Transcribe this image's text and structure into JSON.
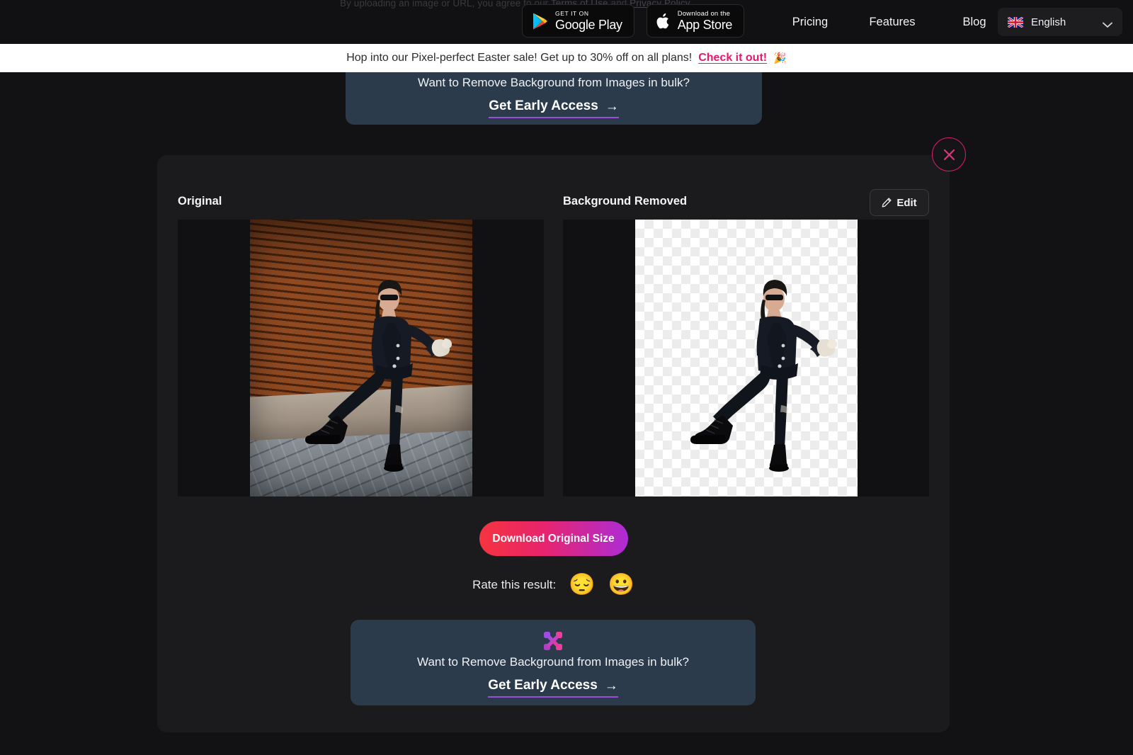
{
  "topnav": {
    "legal_prefix": "By uploading an image or URL, you agree to our ",
    "legal_terms": "Terms of Use",
    "legal_mid": " and ",
    "legal_privacy": "Privacy Policy",
    "legal_suffix": ".",
    "badges": [
      {
        "name": "google-play",
        "small": "GET IT ON",
        "big": "Google Play"
      },
      {
        "name": "app-store",
        "small": "Download on the",
        "big": "App Store"
      }
    ],
    "links": [
      "Pricing",
      "Features",
      "Blog"
    ],
    "language": {
      "label": "English",
      "flag": "uk-flag-icon",
      "chevron": "chevron-down-icon"
    }
  },
  "promo": {
    "text": "Hop into our Pixel-perfect Easter sale! Get up to 30% off on all plans!",
    "cta": "Check it out!",
    "emoji": "🎉",
    "bg": "#ffffff",
    "cta_color": "#e8176f"
  },
  "cta_top": {
    "question": "Want to Remove Background from Images in bulk?",
    "link": "Get Early Access",
    "arrow": "→",
    "bg": "#2c3b4b",
    "underline_color": "#9b4fd8"
  },
  "card": {
    "close_icon": "close-icon",
    "close_color": "#e01b6e",
    "left_label": "Original",
    "right_label": "Background Removed",
    "edit_button": {
      "label": "Edit",
      "icon": "pencil-icon"
    },
    "left_image_alt": "Woman in dark suit kicking leg against brown wooden slat wall on cobblestone street",
    "right_image_alt": "Same woman cut out on transparent checkerboard background",
    "download_button": "Download Original Size",
    "download_gradient": [
      "#f5343f",
      "#e8246c",
      "#ad2cd6"
    ],
    "rate": {
      "label": "Rate this result:",
      "negative_emoji": "😔",
      "positive_emoji": "😀"
    }
  },
  "cta_bottom": {
    "logo_icon": "bulk-x-logo-icon",
    "question": "Want to Remove Background from Images in bulk?",
    "link": "Get Early Access",
    "arrow": "→",
    "bg": "#2c3b4b",
    "underline_color": "#9b4fd8"
  },
  "theme": {
    "page_bg": "#121214",
    "card_bg": "#1b1b1d",
    "panel_bg": "#111113",
    "accent_pink": "#e8176f",
    "accent_purple": "#9b4fd8"
  }
}
